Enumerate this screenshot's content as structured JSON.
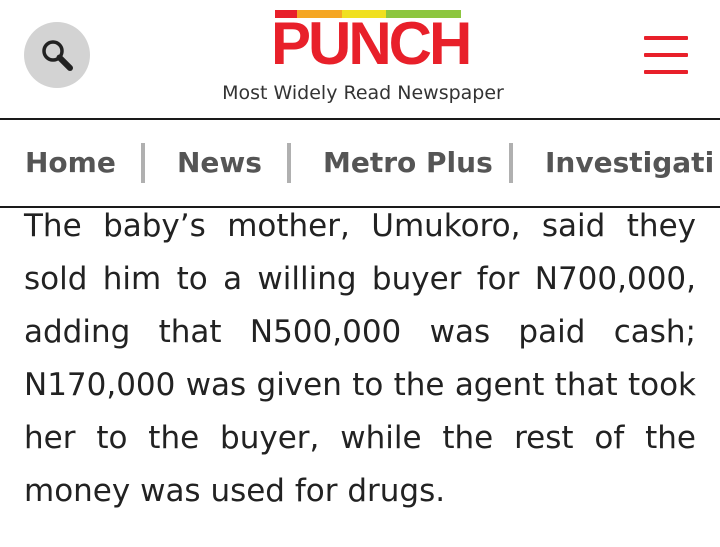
{
  "header": {
    "logo_text": "PUNCH",
    "tagline": "Most Widely Read Newspaper",
    "search_icon": "search-icon",
    "menu_icon": "hamburger-menu-icon",
    "colors": {
      "brand_red": "#e8202a",
      "logo_bar": [
        "#e8202a",
        "#f5a623",
        "#f0e020",
        "#8dc63f"
      ]
    }
  },
  "nav": {
    "items": [
      {
        "label": "Home"
      },
      {
        "label": "News"
      },
      {
        "label": "Metro Plus"
      },
      {
        "label": "Investigati"
      }
    ]
  },
  "article": {
    "paragraph": "The baby’s mother, Umukoro, said they sold him to a willing buyer for N700,000, adding that N500,000 was paid cash; N170,000 was given to the agent that took her to the buyer, while the rest of the money was used for drugs."
  }
}
